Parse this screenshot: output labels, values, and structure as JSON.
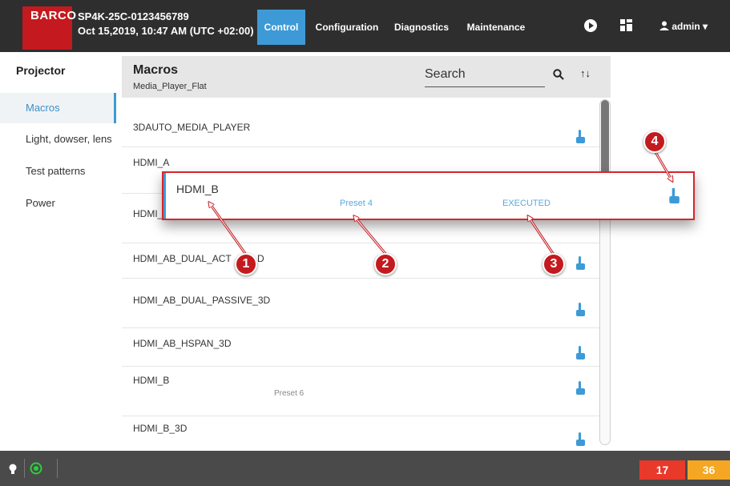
{
  "header": {
    "logo": "BARCO",
    "device_id": "SP4K-25C-0123456789",
    "datetime": "Oct 15,2019, 10:47 AM (UTC +02:00)",
    "tabs": [
      {
        "label": "Control",
        "active": true
      },
      {
        "label": "Configuration",
        "active": false
      },
      {
        "label": "Diagnostics",
        "active": false
      },
      {
        "label": "Maintenance",
        "active": false
      }
    ],
    "icons": [
      "play-icon",
      "layout-grid-icon",
      "user-icon"
    ],
    "user": "admin"
  },
  "sidebar": {
    "title": "Projector",
    "items": [
      {
        "label": "Macros",
        "active": true
      },
      {
        "label": "Light, dowser, lens",
        "active": false
      },
      {
        "label": "Test patterns",
        "active": false
      },
      {
        "label": "Power",
        "active": false
      }
    ]
  },
  "macros_panel": {
    "title": "Macros",
    "subtitle": "Media_Player_Flat",
    "search_label": "Search",
    "icons": [
      "search-icon",
      "sort-icon"
    ],
    "rows": [
      {
        "label": "3DAUTO_MEDIA_PLAYER",
        "preset": ""
      },
      {
        "label": "HDMI_A",
        "preset": ""
      },
      {
        "label": "HDMI_",
        "preset": ""
      },
      {
        "label": "HDMI_AB_DUAL_ACT",
        "preset": "",
        "label_tail": "D"
      },
      {
        "label": "HDMI_AB_DUAL_PASSIVE_3D",
        "preset": ""
      },
      {
        "label": "HDMI_AB_HSPAN_3D",
        "preset": ""
      },
      {
        "label": "HDMI_B",
        "preset": "Preset 6"
      },
      {
        "label": "HDMI_B_3D",
        "preset": ""
      }
    ]
  },
  "overlay": {
    "label": "HDMI_B",
    "preset": "Preset 4",
    "status": "EXECUTED"
  },
  "callouts": [
    "1",
    "2",
    "3",
    "4"
  ],
  "status_bar": {
    "error_count": "17",
    "warning_count": "36"
  },
  "colors": {
    "brand_red": "#c41a1f",
    "accent_blue": "#3d9ad6",
    "error": "#e8392b",
    "warning": "#f5a623",
    "topbar": "#2e2e2e"
  }
}
